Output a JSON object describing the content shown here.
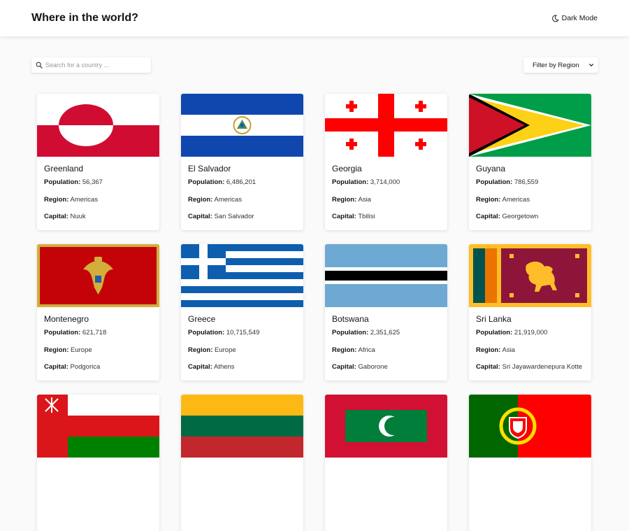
{
  "header": {
    "title": "Where in the world?",
    "dark_mode_label": "Dark Mode",
    "dark_mode_icon": "moon-icon"
  },
  "controls": {
    "search_placeholder": "Search for a country ...",
    "search_value": "",
    "filter_label": "Filter by Region"
  },
  "labels": {
    "population": "Population:",
    "region": "Region:",
    "capital": "Capital:"
  },
  "countries": [
    {
      "name": "Greenland",
      "population": "56,367",
      "region": "Americas",
      "capital": "Nuuk"
    },
    {
      "name": "El Salvador",
      "population": "6,486,201",
      "region": "Americas",
      "capital": "San Salvador"
    },
    {
      "name": "Georgia",
      "population": "3,714,000",
      "region": "Asia",
      "capital": "Tbilisi"
    },
    {
      "name": "Guyana",
      "population": "786,559",
      "region": "Americas",
      "capital": "Georgetown"
    },
    {
      "name": "Montenegro",
      "population": "621,718",
      "region": "Europe",
      "capital": "Podgorica"
    },
    {
      "name": "Greece",
      "population": "10,715,549",
      "region": "Europe",
      "capital": "Athens"
    },
    {
      "name": "Botswana",
      "population": "2,351,625",
      "region": "Africa",
      "capital": "Gaborone"
    },
    {
      "name": "Sri Lanka",
      "population": "21,919,000",
      "region": "Asia",
      "capital": "Sri Jayawardenepura Kotte"
    }
  ],
  "partial_flags": [
    "oman-flag",
    "lithuania-flag",
    "maldives-flag",
    "portugal-flag"
  ],
  "colors": {
    "background": "#fafafa",
    "surface": "#ffffff",
    "text": "#111517"
  }
}
